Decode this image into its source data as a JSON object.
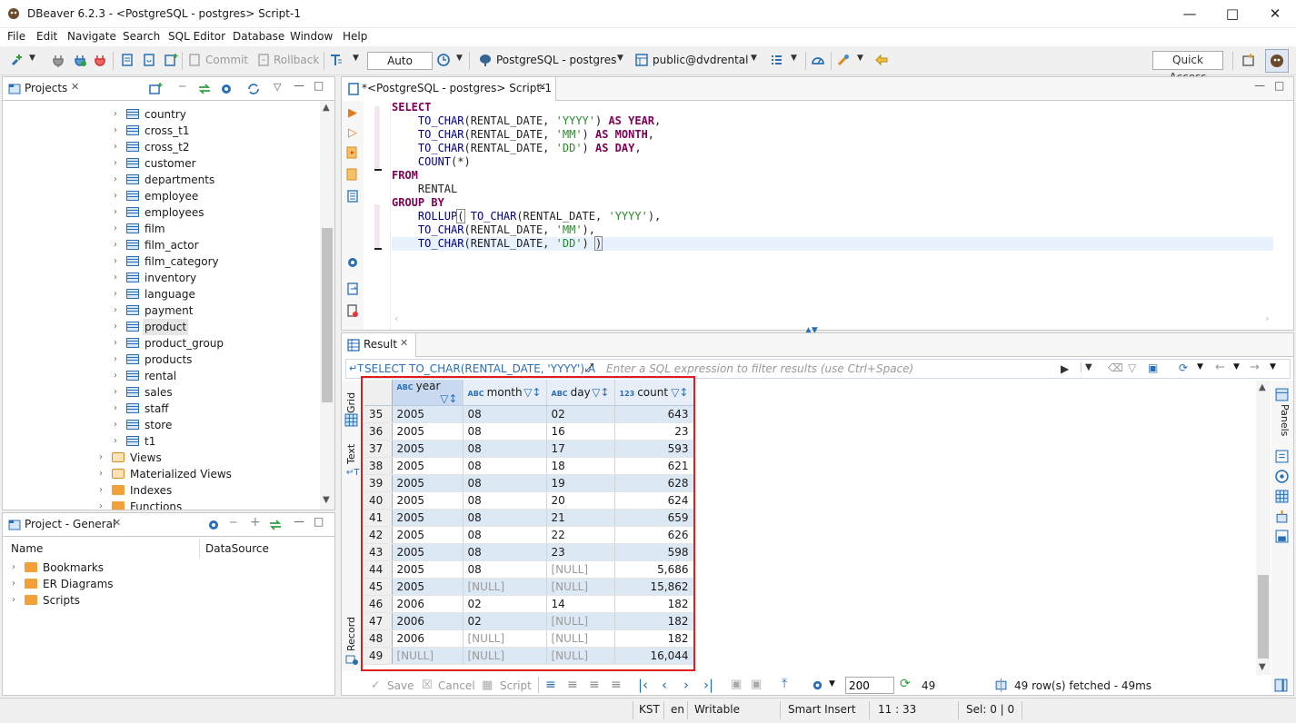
{
  "window": {
    "title": "DBeaver 6.2.3 - <PostgreSQL - postgres> Script-1"
  },
  "menu": [
    "File",
    "Edit",
    "Navigate",
    "Search",
    "SQL Editor",
    "Database",
    "Window",
    "Help"
  ],
  "toolbar": {
    "commit": "Commit",
    "rollback": "Rollback",
    "transaction_mode": "Auto",
    "connection": "PostgreSQL - postgres",
    "schema": "public@dvdrental",
    "quick_access": "Quick Access"
  },
  "projects": {
    "tab": "Projects",
    "tables": [
      "country",
      "cross_t1",
      "cross_t2",
      "customer",
      "departments",
      "employee",
      "employees",
      "film",
      "film_actor",
      "film_category",
      "inventory",
      "language",
      "payment",
      "product",
      "product_group",
      "products",
      "rental",
      "sales",
      "staff",
      "store",
      "t1"
    ],
    "selected": "product",
    "folders": [
      "Views",
      "Materialized Views",
      "Indexes",
      "Functions"
    ]
  },
  "project_general": {
    "tab": "Project - General",
    "col_name": "Name",
    "col_datasource": "DataSource",
    "items": [
      "Bookmarks",
      "ER Diagrams",
      "Scripts"
    ]
  },
  "editor": {
    "tab": "*<PostgreSQL - postgres> Script-1"
  },
  "result": {
    "tab": "Result",
    "query_label": "SELECT TO_CHAR(RENTAL_DATE, 'YYYY') A",
    "filter_placeholder": "Enter a SQL expression to filter results (use Ctrl+Space)",
    "side_tabs": [
      "Grid",
      "Text",
      "Record"
    ],
    "right_tab": "Panels",
    "columns": [
      {
        "type": "ABC",
        "name": "year"
      },
      {
        "type": "ABC",
        "name": "month"
      },
      {
        "type": "ABC",
        "name": "day"
      },
      {
        "type": "123",
        "name": "count"
      }
    ],
    "rows": [
      [
        "35",
        "2005",
        "08",
        "02",
        "643"
      ],
      [
        "36",
        "2005",
        "08",
        "16",
        "23"
      ],
      [
        "37",
        "2005",
        "08",
        "17",
        "593"
      ],
      [
        "38",
        "2005",
        "08",
        "18",
        "621"
      ],
      [
        "39",
        "2005",
        "08",
        "19",
        "628"
      ],
      [
        "40",
        "2005",
        "08",
        "20",
        "624"
      ],
      [
        "41",
        "2005",
        "08",
        "21",
        "659"
      ],
      [
        "42",
        "2005",
        "08",
        "22",
        "626"
      ],
      [
        "43",
        "2005",
        "08",
        "23",
        "598"
      ],
      [
        "44",
        "2005",
        "08",
        "[NULL]",
        "5,686"
      ],
      [
        "45",
        "2005",
        "[NULL]",
        "[NULL]",
        "15,862"
      ],
      [
        "46",
        "2006",
        "02",
        "14",
        "182"
      ],
      [
        "47",
        "2006",
        "02",
        "[NULL]",
        "182"
      ],
      [
        "48",
        "2006",
        "[NULL]",
        "[NULL]",
        "182"
      ],
      [
        "49",
        "[NULL]",
        "[NULL]",
        "[NULL]",
        "16,044"
      ]
    ],
    "bottom": {
      "save": "Save",
      "cancel": "Cancel",
      "script": "Script",
      "fetch_size": "200",
      "row_count": "49",
      "status": "49 row(s) fetched - 49ms"
    }
  },
  "statusbar": {
    "timezone": "KST",
    "locale": "en",
    "mode": "Writable",
    "insert": "Smart Insert",
    "position": "11 : 33",
    "selection": "Sel: 0 | 0"
  },
  "colors": {
    "highlight_border": "#e41b1b",
    "keyword": "#7f0055",
    "string": "#2a8a2a",
    "accent": "#2a6fb5"
  }
}
